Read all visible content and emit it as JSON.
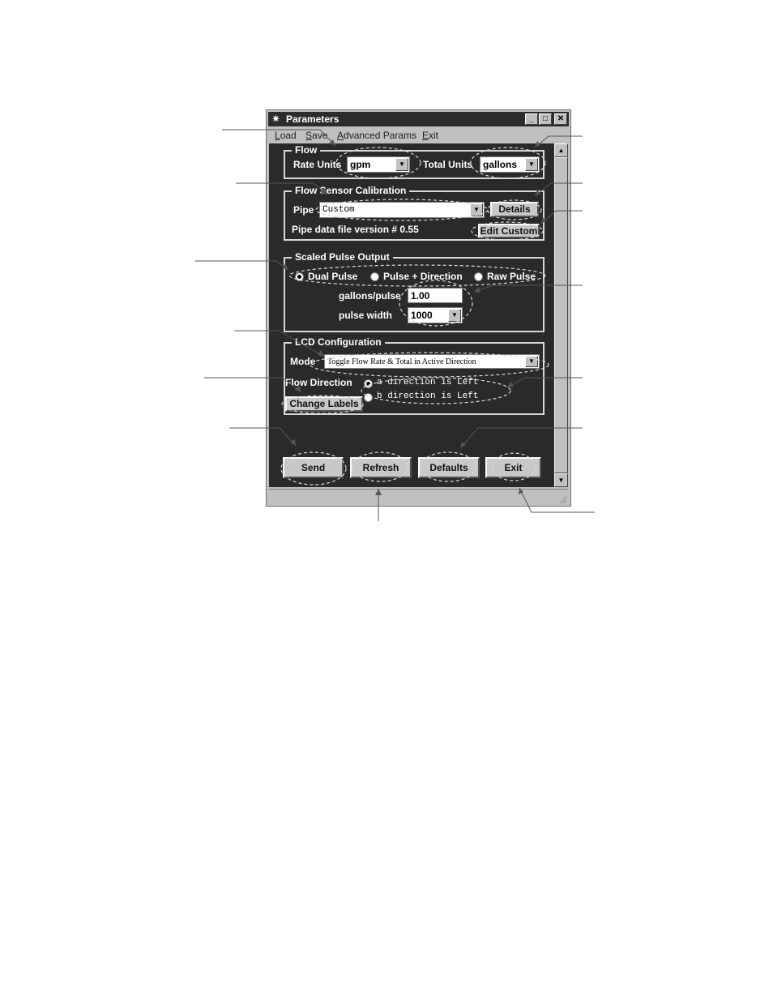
{
  "window": {
    "title": "Parameters",
    "controls": {
      "minimize": "_",
      "maximize": "□",
      "close": "✕"
    },
    "app_icon": "star-burst-icon"
  },
  "menu": [
    "Load",
    "Save",
    "Advanced Params",
    "Exit"
  ],
  "flow": {
    "legend": "Flow",
    "rate_units_label": "Rate Units",
    "rate_units_value": "gpm",
    "total_units_label": "Total Units",
    "total_units_value": "gallons"
  },
  "calibration": {
    "legend": "Flow Sensor Calibration",
    "pipe_label": "Pipe",
    "pipe_value": "Custom",
    "details_label": "Details",
    "version_text": "Pipe data file version # 0.55",
    "edit_custom_label": "Edit Custom"
  },
  "pulse": {
    "legend": "Scaled Pulse Output",
    "options": [
      "Dual Pulse",
      "Pulse + Direction",
      "Raw Pulse"
    ],
    "selected": "Dual Pulse",
    "gallons_per_pulse_label": "gallons/pulse",
    "gallons_per_pulse_value": "1.00",
    "pulse_width_label": "pulse width",
    "pulse_width_value": "1000"
  },
  "lcd": {
    "legend": "LCD Configuration",
    "mode_label": "Mode",
    "mode_value": "Toggle Flow Rate & Total in Active Direction",
    "flow_direction_label": "Flow Direction",
    "direction_options": [
      "a direction is Left",
      "b direction is Left"
    ],
    "selected": "a direction is Left",
    "change_labels": "Change Labels"
  },
  "buttons": {
    "send": "Send",
    "refresh": "Refresh",
    "defaults": "Defaults",
    "exit": "Exit"
  }
}
